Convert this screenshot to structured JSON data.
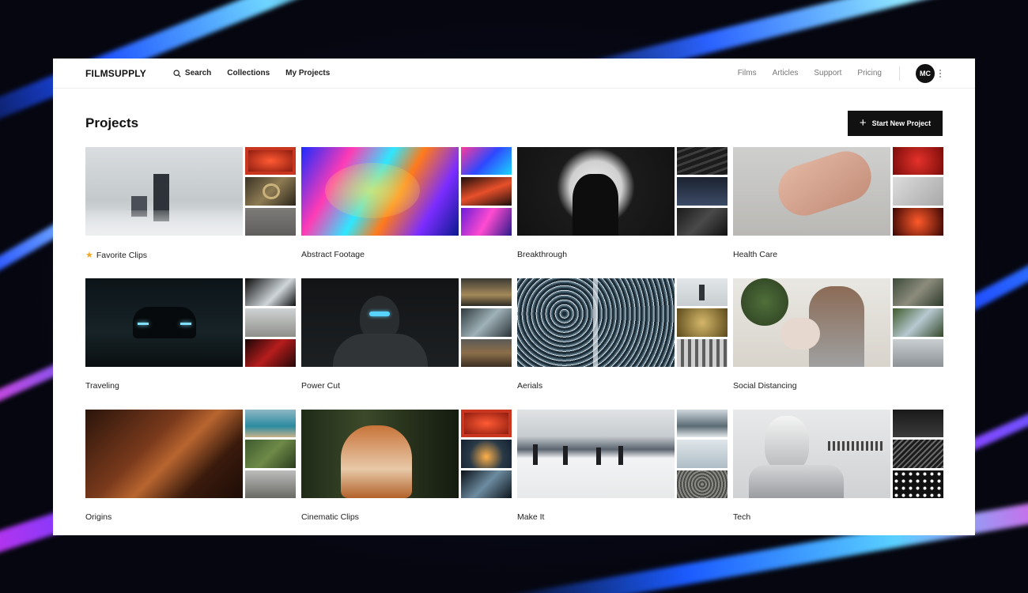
{
  "app": {
    "brand": "FILMSUPPLY"
  },
  "nav": {
    "search_label": "Search",
    "collections_label": "Collections",
    "my_projects_label": "My Projects",
    "films_label": "Films",
    "articles_label": "Articles",
    "support_label": "Support",
    "pricing_label": "Pricing",
    "avatar_initials": "MC"
  },
  "page": {
    "title": "Projects",
    "new_project_label": "Start New Project"
  },
  "projects": [
    {
      "label": "Favorite Clips",
      "starred": true
    },
    {
      "label": "Abstract Footage"
    },
    {
      "label": "Breakthrough"
    },
    {
      "label": "Health Care"
    },
    {
      "label": "Traveling"
    },
    {
      "label": "Power Cut"
    },
    {
      "label": "Aerials"
    },
    {
      "label": "Social Distancing"
    },
    {
      "label": "Origins"
    },
    {
      "label": "Cinematic Clips"
    },
    {
      "label": "Make It"
    },
    {
      "label": "Tech"
    }
  ],
  "icons": {
    "search": "search-icon",
    "star": "star-icon",
    "plus": "plus-icon",
    "kebab": "kebab-menu-icon"
  },
  "colors": {
    "accent_star": "#f4a623",
    "button_bg": "#111111"
  }
}
